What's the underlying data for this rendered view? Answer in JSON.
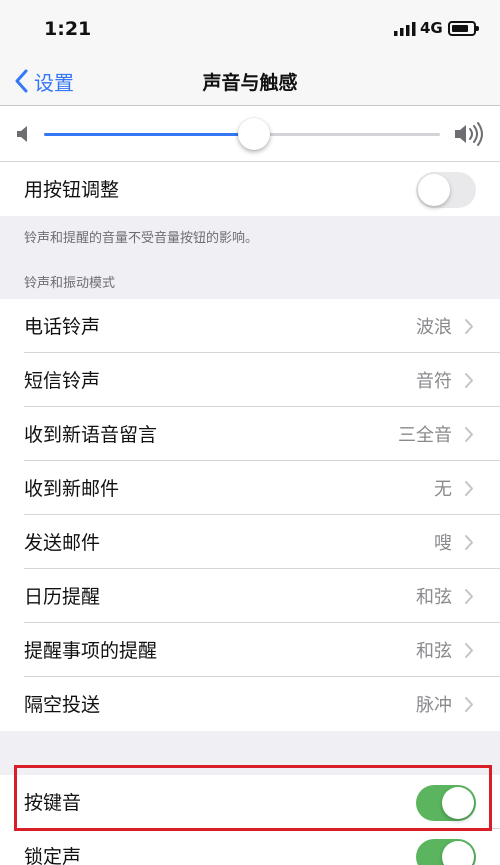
{
  "status": {
    "time": "1:21",
    "network": "4G",
    "icons": [
      "signal-icon",
      "battery-icon"
    ]
  },
  "nav": {
    "back_label": "设置",
    "title": "声音与触感",
    "back_icon": "chevron-left-icon"
  },
  "volume": {
    "level_fraction": 0.53,
    "low_icon": "speaker-low-icon",
    "high_icon": "speaker-high-icon"
  },
  "buttons_adjust": {
    "label": "用按钮调整",
    "on": false
  },
  "footnote": "铃声和提醒的音量不受音量按钮的影响。",
  "section_header": "铃声和振动模式",
  "sounds": [
    {
      "label": "电话铃声",
      "value": "波浪"
    },
    {
      "label": "短信铃声",
      "value": "音符"
    },
    {
      "label": "收到新语音留言",
      "value": "三全音"
    },
    {
      "label": "收到新邮件",
      "value": "无"
    },
    {
      "label": "发送邮件",
      "value": "嗖"
    },
    {
      "label": "日历提醒",
      "value": "和弦"
    },
    {
      "label": "提醒事项的提醒",
      "value": "和弦"
    },
    {
      "label": "隔空投送",
      "value": "脉冲"
    }
  ],
  "keyboard_clicks": {
    "label": "按键音",
    "on": true
  },
  "lock_sound": {
    "label": "锁定声",
    "on": true
  },
  "colors": {
    "accent": "#3478f6",
    "toggle_on": "#5ab55e",
    "highlight": "#d81e28"
  }
}
